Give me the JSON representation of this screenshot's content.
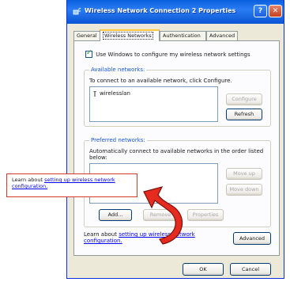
{
  "window": {
    "title": "Wireless Network Connection 2 Properties",
    "help_label": "?",
    "close_label": "✕"
  },
  "tabs": [
    {
      "label": "General"
    },
    {
      "label": "Wireless Networks"
    },
    {
      "label": "Authentication"
    },
    {
      "label": "Advanced"
    }
  ],
  "checkbox": {
    "label": "Use Windows to configure my wireless network settings",
    "checked": true
  },
  "available": {
    "title": "Available networks:",
    "description": "To connect to an available network, click Configure.",
    "items": [
      {
        "label": "wirelesslan"
      }
    ],
    "configure_label": "Configure",
    "refresh_label": "Refresh"
  },
  "preferred": {
    "title": "Preferred networks:",
    "description": "Automatically connect to available networks in the order listed below:",
    "move_up_label": "Move up",
    "move_down_label": "Move down",
    "add_label": "Add...",
    "remove_label": "Remove",
    "properties_label": "Properties"
  },
  "learn": {
    "prefix": "Learn about ",
    "link": "setting up wireless network configuration."
  },
  "advanced_label": "Advanced",
  "ok_label": "OK",
  "cancel_label": "Cancel",
  "callout": {
    "prefix": "Learn about ",
    "link": "setting up wireless network configuration."
  },
  "colors": {
    "titlebar": "#0a5fde",
    "dialog_bg": "#ece9d8",
    "link": "#0000ff",
    "accent_red": "#d63a2a"
  }
}
